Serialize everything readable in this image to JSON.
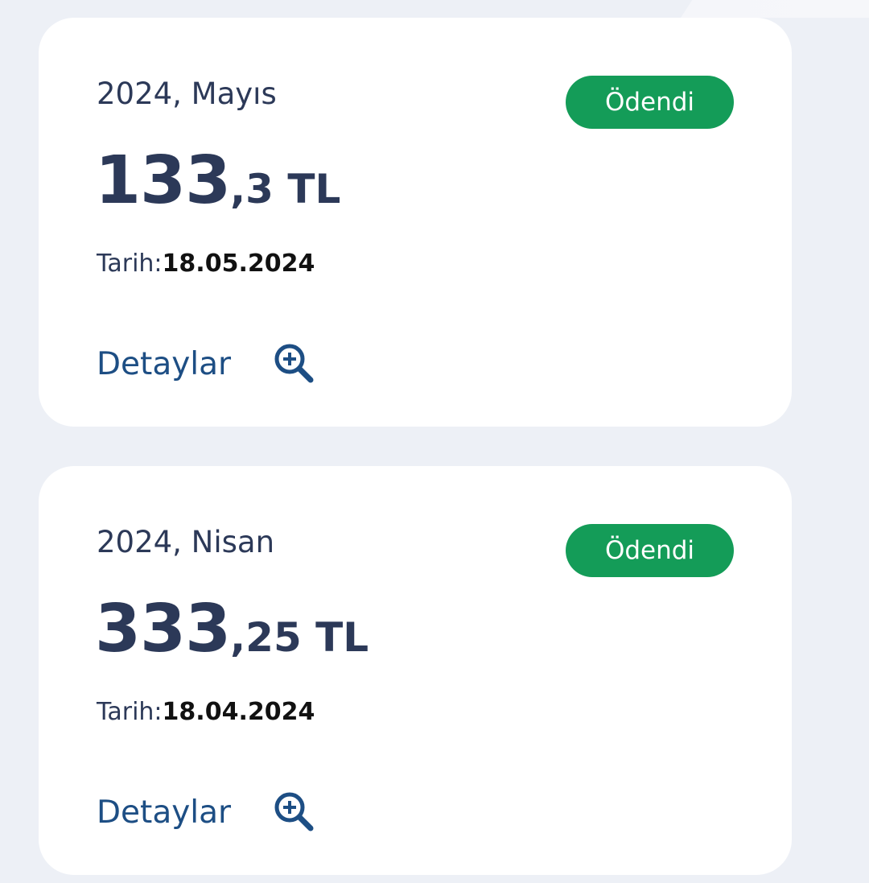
{
  "colors": {
    "background": "#edf0f6",
    "card": "#ffffff",
    "primary_text": "#2c3958",
    "link": "#1d4e84",
    "paid_badge": "#149c58"
  },
  "payments": [
    {
      "period": "2024, Mayıs",
      "status": "Ödendi",
      "amount_int": "133",
      "amount_dec": ",3",
      "currency": " TL",
      "date_label": "Tarih:",
      "date_value": "18.05.2024",
      "details_label": "Detaylar",
      "details_icon": "zoom-in-icon"
    },
    {
      "period": "2024, Nisan",
      "status": "Ödendi",
      "amount_int": "333",
      "amount_dec": ",25",
      "currency": " TL",
      "date_label": "Tarih:",
      "date_value": "18.04.2024",
      "details_label": "Detaylar",
      "details_icon": "zoom-in-icon"
    }
  ]
}
